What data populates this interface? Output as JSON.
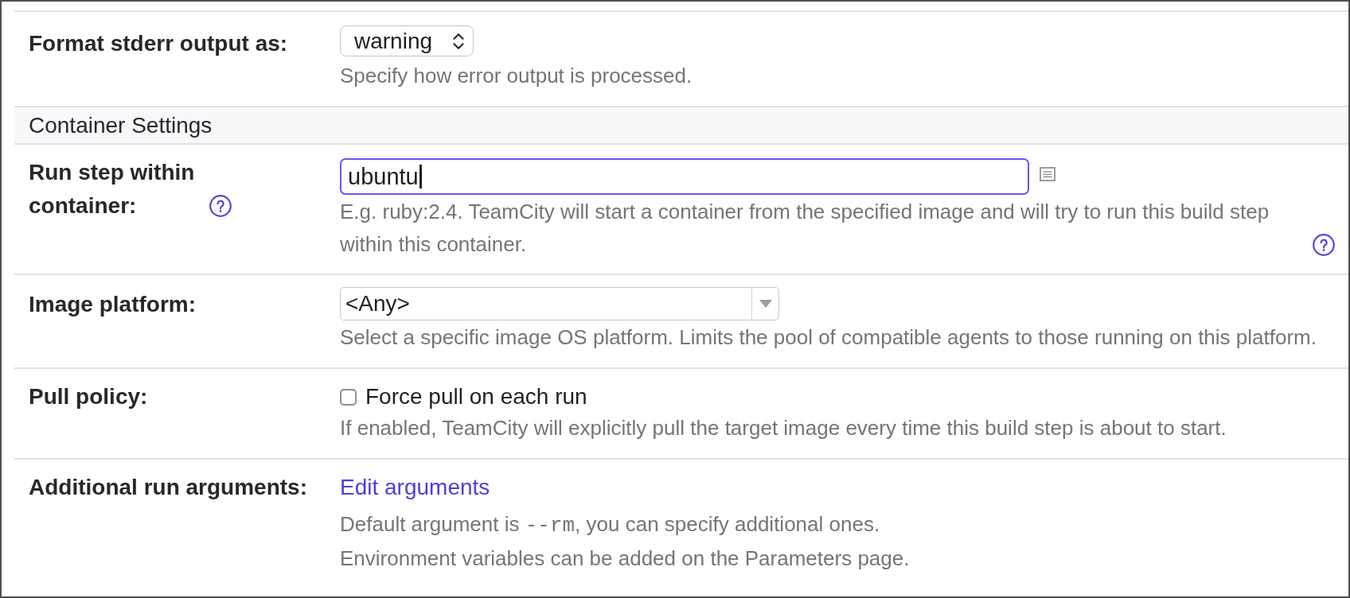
{
  "rows": [
    {
      "kind": "field",
      "label": "Format stderr output as:",
      "control": {
        "kind": "select",
        "value": "warning"
      },
      "hints": [
        {
          "parts": [
            {
              "kind": "text",
              "text": "Specify how error output is processed."
            }
          ]
        }
      ]
    },
    {
      "kind": "section",
      "title": "Container Settings"
    },
    {
      "kind": "field",
      "label": "Run step within container:",
      "label_help": true,
      "control": {
        "kind": "text_input",
        "value": "ubuntu",
        "focused": true
      },
      "hints": [
        {
          "parts": [
            {
              "kind": "text",
              "text": "E.g. ruby:2.4. TeamCity will start a container from the specified image and will try to run this build step within this container."
            }
          ],
          "help": true
        }
      ]
    },
    {
      "kind": "field",
      "label": "Image platform:",
      "control": {
        "kind": "combo",
        "value": "<Any>"
      },
      "hints": [
        {
          "parts": [
            {
              "kind": "text",
              "text": "Select a specific image OS platform. Limits the pool of compatible agents to those running on this platform."
            }
          ]
        }
      ]
    },
    {
      "kind": "field",
      "label": "Pull policy:",
      "control": {
        "kind": "checkbox",
        "text": "Force pull on each run",
        "checked": false
      },
      "hints": [
        {
          "parts": [
            {
              "kind": "text",
              "text": "If enabled, TeamCity will explicitly pull the target image every time this build step is about to start."
            }
          ]
        }
      ]
    },
    {
      "kind": "field",
      "label": "Additional run arguments:",
      "control": {
        "kind": "link",
        "text": "Edit arguments"
      },
      "hints": [
        {
          "parts": [
            {
              "kind": "text",
              "text": "Default argument is "
            },
            {
              "kind": "code",
              "text": "--rm"
            },
            {
              "kind": "text",
              "text": ", you can specify additional ones."
            }
          ]
        },
        {
          "parts": [
            {
              "kind": "text",
              "text": "Environment variables can be added on the Parameters page."
            }
          ]
        }
      ]
    }
  ]
}
